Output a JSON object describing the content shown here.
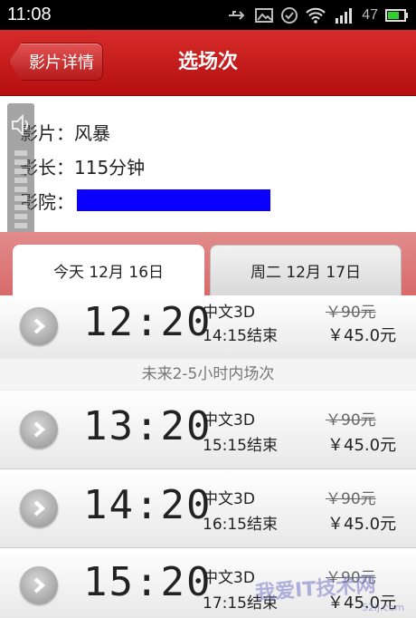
{
  "status": {
    "time": "11:08",
    "battery": "47"
  },
  "header": {
    "back_label": "影片详情",
    "title": "选场次"
  },
  "movie": {
    "film_label": "影片：",
    "film_value": "风暴",
    "length_label": "影长：",
    "length_value": "115分钟",
    "cinema_label": "影院："
  },
  "tabs": [
    {
      "label": "今天 12月 16日",
      "active": true
    },
    {
      "label": "周二 12月 17日",
      "active": false
    }
  ],
  "section_label": "未来2-5小时内场次",
  "showtimes": [
    {
      "time": "12:20",
      "lang": "中文3D",
      "end": "14:15结束",
      "orig_price": "￥90元",
      "price": "￥45.0元"
    },
    {
      "time": "13:20",
      "lang": "中文3D",
      "end": "15:15结束",
      "orig_price": "￥90元",
      "price": "￥45.0元"
    },
    {
      "time": "14:20",
      "lang": "中文3D",
      "end": "16:15结束",
      "orig_price": "￥90元",
      "price": "￥45.0元"
    },
    {
      "time": "15:20",
      "lang": "中文3D",
      "end": "17:15结束",
      "orig_price": "￥90元",
      "price": "￥45.0元"
    }
  ],
  "watermark": {
    "text": "我爱IT技术网",
    "sub": "52ij.com"
  },
  "colors": {
    "header_red": "#c41a1a",
    "redaction_blue": "#0a00ff"
  }
}
